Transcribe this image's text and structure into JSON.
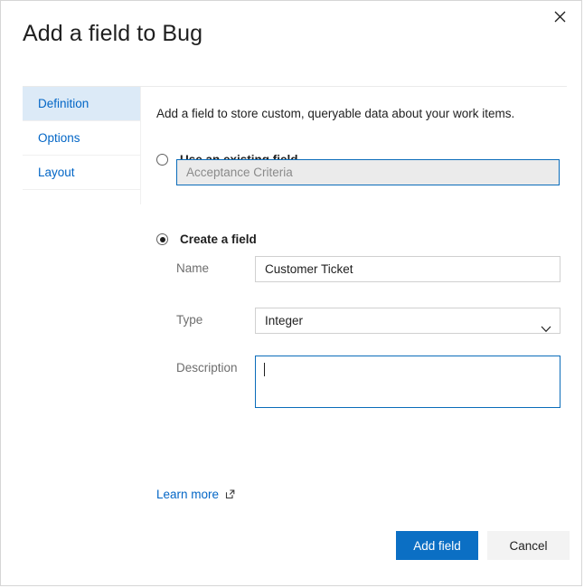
{
  "dialog": {
    "title": "Add a field to Bug",
    "close_icon": "close-icon"
  },
  "sidebar": {
    "items": [
      {
        "label": "Definition",
        "selected": true
      },
      {
        "label": "Options",
        "selected": false
      },
      {
        "label": "Layout",
        "selected": false
      }
    ]
  },
  "main": {
    "intro": "Add a field to store custom, queryable data about your work items.",
    "existing_field": {
      "radio_label": "Use an existing field",
      "selected": false,
      "value": "Acceptance Criteria"
    },
    "create_field": {
      "radio_label": "Create a field",
      "selected": true,
      "name": {
        "label": "Name",
        "value": "Customer Ticket"
      },
      "type": {
        "label": "Type",
        "value": "Integer",
        "chevron_icon": "chevron-down-icon"
      },
      "description": {
        "label": "Description",
        "value": "",
        "placeholder": ""
      }
    },
    "learn_more": {
      "label": "Learn more",
      "icon": "external-link-icon"
    }
  },
  "footer": {
    "primary_label": "Add field",
    "secondary_label": "Cancel"
  },
  "colors": {
    "accent": "#0b6fc4",
    "link": "#0366c6",
    "selected_tab_bg": "#dceaf7",
    "focus_border": "#0a6cba",
    "disabled_bg": "#ebebeb"
  }
}
